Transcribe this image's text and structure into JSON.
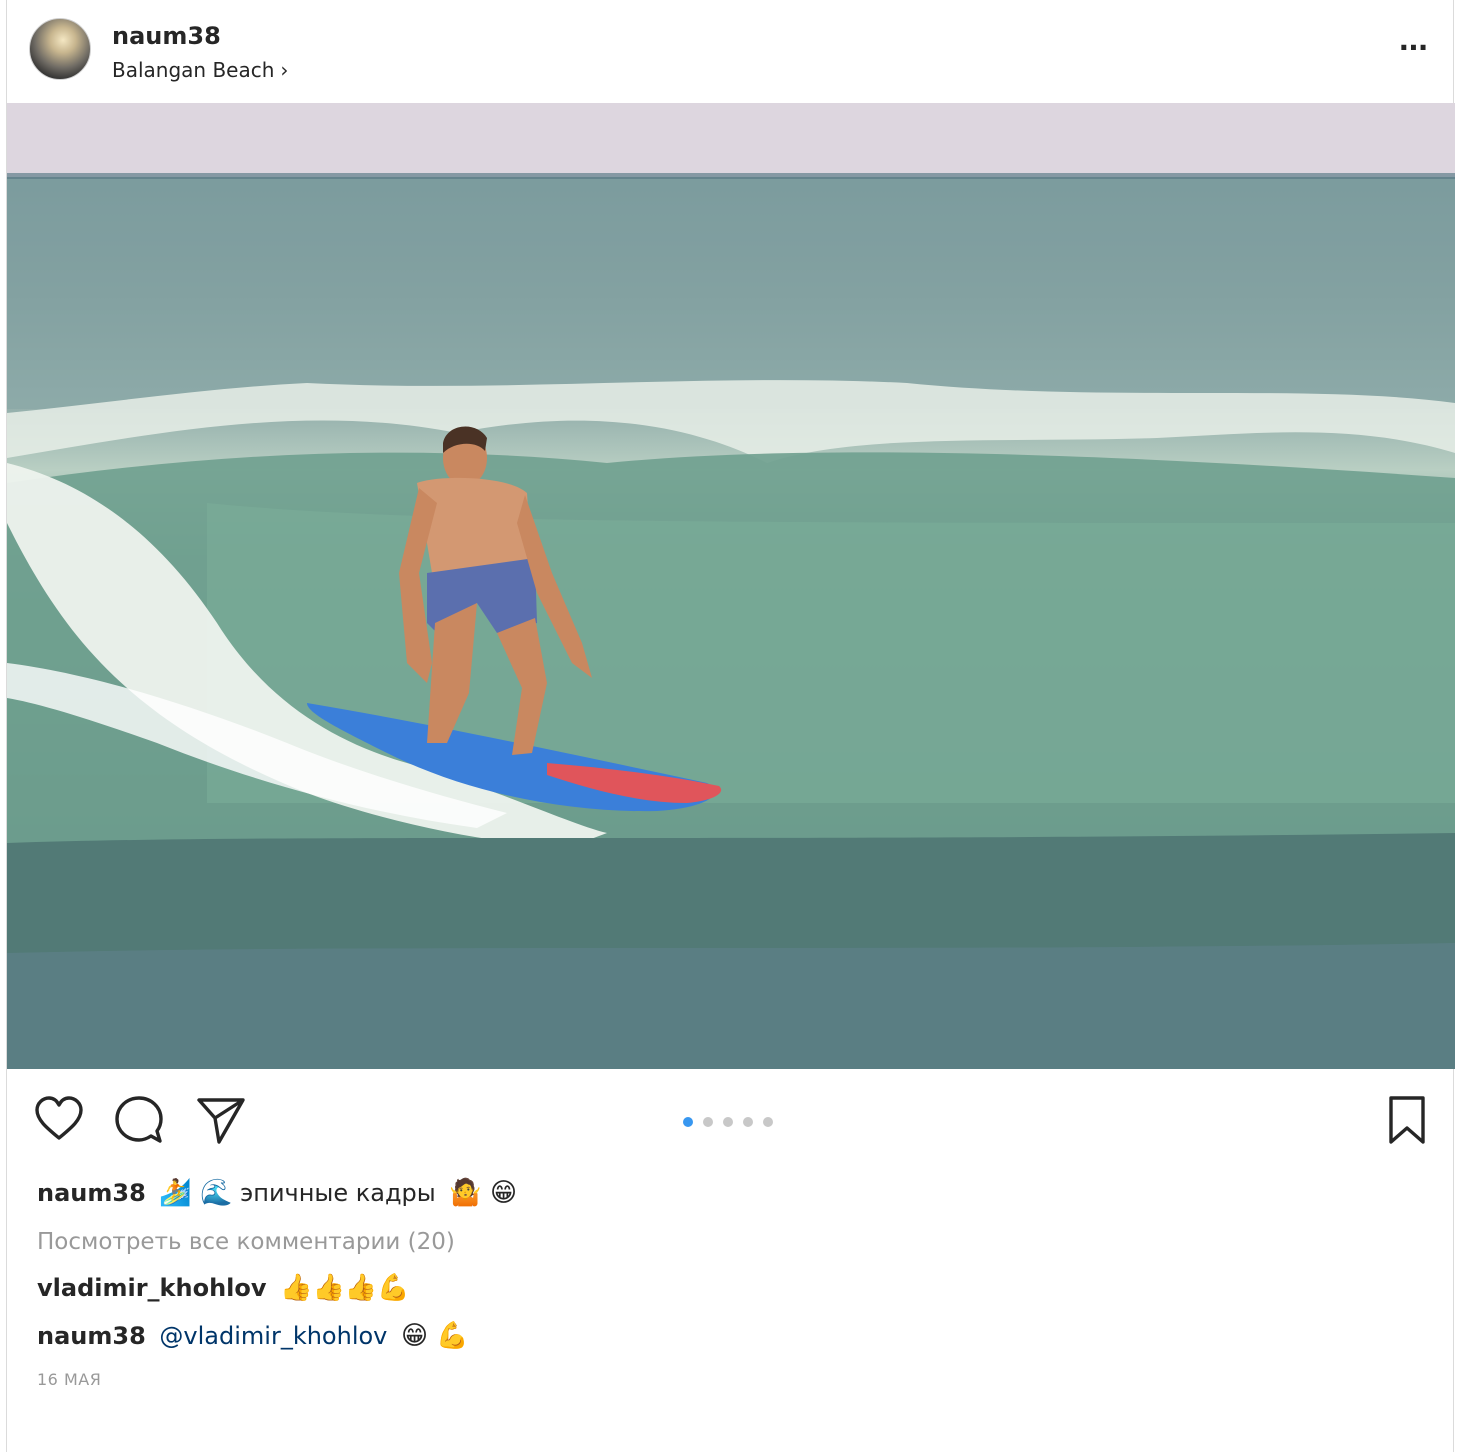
{
  "post": {
    "username": "naum38",
    "location": "Balangan Beach",
    "location_chevron": "›",
    "more_icon": "···",
    "carousel": {
      "count": 5,
      "active_index": 0,
      "active_color": "#3897f0",
      "inactive_color": "#c8c8c8"
    },
    "caption": {
      "username": "naum38",
      "emoji_before": "🏄 🌊",
      "text": "эпичные кадры",
      "emoji_after": "🤷 😁"
    },
    "view_all_comments": "Посмотреть все комментарии (20)",
    "comments": [
      {
        "username": "vladimir_khohlov",
        "text": "👍👍👍💪"
      },
      {
        "username": "naum38",
        "mention": "@vladimir_khohlov",
        "text": "😁 💪"
      }
    ],
    "date": "16 МАЯ"
  }
}
